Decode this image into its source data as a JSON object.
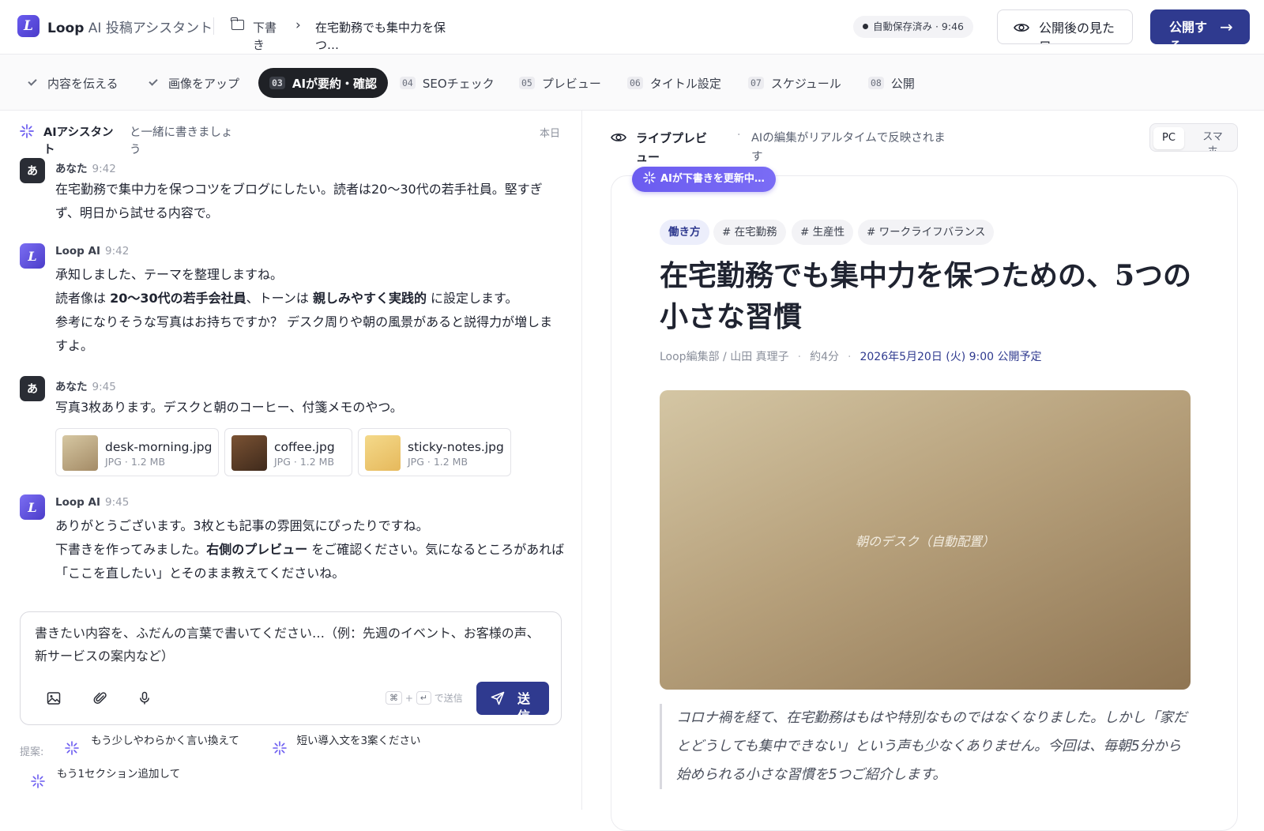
{
  "header": {
    "brand": "Loop",
    "brand_sub": "AI 投稿アシスタント",
    "breadcrumb_folder": "下書き",
    "breadcrumb_current": "在宅勤務でも集中力を保つ…",
    "autosave": "自動保存済み · 9:46",
    "view_button": "公開後の見た目",
    "publish_button": "公開する"
  },
  "steps": [
    {
      "num": "",
      "label": "内容を伝える",
      "state": "done"
    },
    {
      "num": "",
      "label": "画像をアップ",
      "state": "done"
    },
    {
      "num": "03",
      "label": "AIが要約・確認",
      "state": "active"
    },
    {
      "num": "04",
      "label": "SEOチェック",
      "state": "todo"
    },
    {
      "num": "05",
      "label": "プレビュー",
      "state": "todo"
    },
    {
      "num": "06",
      "label": "タイトル設定",
      "state": "todo"
    },
    {
      "num": "07",
      "label": "スケジュール",
      "state": "todo"
    },
    {
      "num": "08",
      "label": "公開",
      "state": "todo"
    }
  ],
  "chat": {
    "title": "AIアシスタント",
    "subtitle": "と一緒に書きましょう",
    "date": "本日",
    "messages": [
      {
        "avatar": "あ",
        "name": "あなた",
        "time": "9:42",
        "text": "在宅勤務で集中力を保つコツをブログにしたい。読者は20〜30代の若手社員。堅すぎず、明日から試せる内容で。"
      },
      {
        "avatar": "L",
        "name": "Loop AI",
        "time": "9:42",
        "line1": "承知しました、テーマを整理しますね。",
        "line2_a": "読者像は ",
        "line2_b": "20〜30代の若手会社員",
        "line2_c": "、トーンは ",
        "line2_d": "親しみやすく実践的",
        "line2_e": " に設定します。",
        "line3": "参考になりそうな写真はお持ちですか？ デスク周りや朝の風景があると説得力が増しますよ。"
      },
      {
        "avatar": "あ",
        "name": "あなた",
        "time": "9:45",
        "text": "写真3枚あります。デスクと朝のコーヒー、付箋メモのやつ。"
      },
      {
        "avatar": "L",
        "name": "Loop AI",
        "time": "9:45",
        "line1": "ありがとうございます。3枚とも記事の雰囲気にぴったりですね。",
        "line2_a": "下書きを作ってみました。",
        "line2_b": "右側のプレビュー",
        "line2_c": " をご確認ください。気になるところがあれば「ここを直したい」とそのまま教えてくださいね。"
      }
    ],
    "attachments": [
      {
        "name": "desk-morning.jpg",
        "meta": "JPG · 1.2 MB"
      },
      {
        "name": "coffee.jpg",
        "meta": "JPG · 1.2 MB"
      },
      {
        "name": "sticky-notes.jpg",
        "meta": "JPG · 1.2 MB"
      }
    ],
    "composer_placeholder": "書きたい内容を、ふだんの言葉で書いてください…（例：先週のイベント、お客様の声、新サービスの案内など）",
    "shortcut_key1": "⌘",
    "shortcut_plus": "+",
    "shortcut_key2": "↵",
    "shortcut_hint": "で送信",
    "send_button": "送信",
    "suggestions_label": "提案:",
    "suggestions": [
      "もう少しやわらかく言い換えて",
      "短い導入文を3案ください",
      "もう1セクション追加して"
    ]
  },
  "preview": {
    "title": "ライブプレビュー",
    "subtitle": "AIの編集がリアルタイムで反映されます",
    "device_pc": "PC",
    "device_sp": "スマホ",
    "ai_badge": "AIが下書きを更新中…",
    "category": "働き方",
    "hashtags": [
      "# 在宅勤務",
      "# 生産性",
      "# ワークライフバランス"
    ],
    "article_title": "在宅勤務でも集中力を保つための、5つの小さな習慣",
    "author": "Loop編集部 / 山田 真理子",
    "read_time": "約4分",
    "schedule": "2026年5月20日 (火) 9:00 公開予定",
    "hero_caption": "朝のデスク（自動配置）",
    "lead": "コロナ禍を経て、在宅勤務はもはや特別なものではなくなりました。しかし「家だとどうしても集中できない」という声も少なくありません。今回は、毎朝5分から始められる小さな習慣を5つご紹介します。"
  },
  "colors": {
    "accent": "#2f3a8f",
    "ai_purple": "#6b5cf0",
    "active_step": "#1f2126"
  }
}
